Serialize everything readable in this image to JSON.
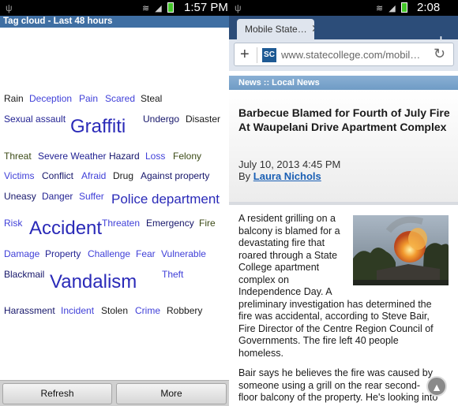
{
  "left_screen": {
    "status": {
      "time": "1:57 PM"
    },
    "header": "Tag cloud - Last 48 hours",
    "tags": [
      {
        "text": "Rain"
      },
      {
        "text": "Deception"
      },
      {
        "text": "Pain"
      },
      {
        "text": "Scared"
      },
      {
        "text": "Steal"
      },
      {
        "text": "Sexual assault"
      },
      {
        "text": "Graffiti"
      },
      {
        "text": "Undergo"
      },
      {
        "text": "Disaster"
      },
      {
        "text": "Threat"
      },
      {
        "text": "Severe Weather"
      },
      {
        "text": "Hazard"
      },
      {
        "text": "Loss"
      },
      {
        "text": "Felony"
      },
      {
        "text": "Victims"
      },
      {
        "text": "Conflict"
      },
      {
        "text": "Afraid"
      },
      {
        "text": "Drug"
      },
      {
        "text": "Against property"
      },
      {
        "text": "Uneasy"
      },
      {
        "text": "Danger"
      },
      {
        "text": "Suffer"
      },
      {
        "text": "Police department"
      },
      {
        "text": "Risk"
      },
      {
        "text": "Accident"
      },
      {
        "text": "Threaten"
      },
      {
        "text": "Emergency"
      },
      {
        "text": "Fire"
      },
      {
        "text": "Damage"
      },
      {
        "text": "Property"
      },
      {
        "text": "Challenge"
      },
      {
        "text": "Fear"
      },
      {
        "text": "Vulnerable"
      },
      {
        "text": "Blackmail"
      },
      {
        "text": "Vandalism"
      },
      {
        "text": "Theft"
      },
      {
        "text": "Harassment"
      },
      {
        "text": "Incident"
      },
      {
        "text": "Stolen"
      },
      {
        "text": "Crime"
      },
      {
        "text": "Robbery"
      }
    ],
    "buttons": {
      "refresh": "Refresh",
      "more": "More"
    }
  },
  "right_screen": {
    "status": {
      "time": "2:08 PM"
    },
    "tab_title": "Mobile State…",
    "url": "www.statecollege.com/mobil…",
    "favicon_text": "SC",
    "section": "News :: Local News",
    "headline": "Barbecue Blamed for Fourth of July Fire At Waupelani Drive Apartment Complex",
    "date": "July 10, 2013 4:45 PM",
    "by_prefix": "By ",
    "author": "Laura Nichols",
    "paragraph1_lines": [
      "A resident grilling on a",
      "balcony is blamed for a",
      "devastating fire that",
      "roared through a State",
      "College apartment",
      "complex on",
      "Independence Day. A",
      "preliminary investigation has determined the",
      "fire was accidental, according to Steve Bair,",
      "Fire Director of the Centre Region Council of",
      "Governments. The fire left 40 people",
      "homeless."
    ],
    "paragraph2_lines": [
      "Bair says he believes the fire was caused by",
      "someone using a grill on the rear second-",
      "floor balcony of the property. He's looking into"
    ]
  }
}
